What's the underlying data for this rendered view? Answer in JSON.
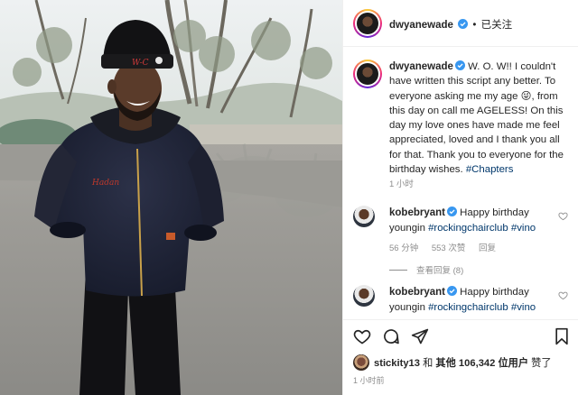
{
  "colors": {
    "link": "#00376b",
    "verified": "#3897f0",
    "muted": "#8e8e8e",
    "text": "#262626"
  },
  "header": {
    "username": "dwyanewade",
    "separator": "•",
    "follow_state": "已关注"
  },
  "caption": {
    "username": "dwyanewade",
    "text_1": "W. O. W!! I couldn't have written this script any better. To everyone asking me my age ",
    "emoji": "😜",
    "text_2": ", from this day on call me AGELESS! On this day my love ones have made me feel appreciated, loved and I thank you all for that. Thank you to everyone for the birthday wishes. ",
    "hashtag": "#Chapters",
    "age": "1 小时"
  },
  "comments": [
    {
      "username": "kobebryant",
      "text": "Happy birthday youngin ",
      "tag_1": "#rockingchairclub",
      "tag_2": "#vino",
      "meta_time": "56 分钟",
      "meta_likes": "553 次赞",
      "meta_reply": "回复",
      "view_replies": "查看回复 (8)"
    },
    {
      "username": "kobebryant",
      "text": "Happy birthday youngin ",
      "tag_1": "#rockingchairclub",
      "tag_2": "#vino"
    }
  ],
  "likes": {
    "user": "stickity13",
    "connector": "和",
    "others_label": "其他",
    "count": "106,342",
    "suffix": "位用户",
    "action": "赞了"
  },
  "post_age": "1 小时前",
  "icons": [
    "heart-icon",
    "comment-icon",
    "share-icon",
    "bookmark-icon",
    "verified-badge-icon",
    "small-heart-icon"
  ],
  "photo": {
    "cap_text": "W-C"
  }
}
